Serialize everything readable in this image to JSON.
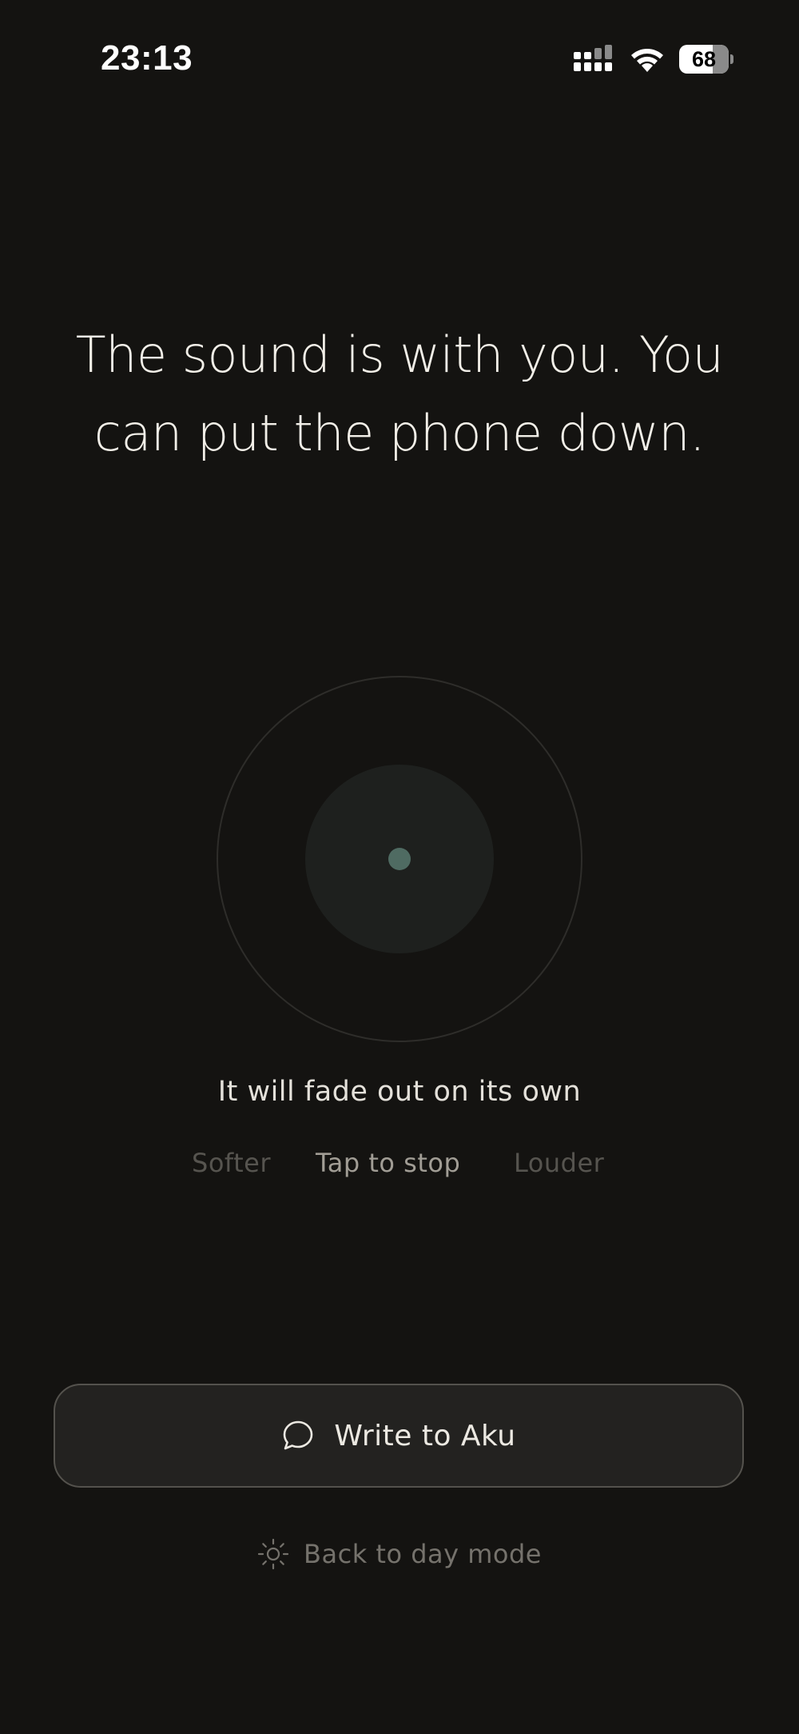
{
  "status_bar": {
    "time": "23:13",
    "battery_level": "68",
    "battery_fraction": 0.68,
    "icons": [
      "signal-icon",
      "wifi-icon",
      "battery-icon"
    ]
  },
  "headline": {
    "line1": "The sound is with you. You",
    "line2": "can put the phone down."
  },
  "player": {
    "status_text": "It will fade out on its own",
    "icons": [
      "playback-indicator-icon"
    ]
  },
  "controls": {
    "softer": "Softer",
    "stop": "Tap to stop",
    "louder": "Louder"
  },
  "write_button": {
    "label": "Write to Aku",
    "icon": "chat-bubble-icon"
  },
  "day_mode": {
    "label": "Back to day mode",
    "icon": "sun-icon"
  },
  "colors": {
    "background": "#141311",
    "text_primary": "#f2efe8",
    "text_muted": "#56544f",
    "accent_dot": "#4f6b62",
    "button_bg": "#232220",
    "button_border": "#54524d"
  }
}
